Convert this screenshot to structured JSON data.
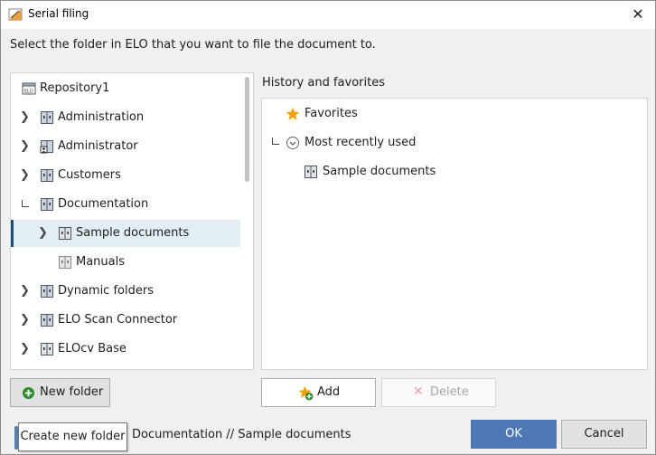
{
  "window": {
    "title": "Serial filing",
    "close_glyph": "✕"
  },
  "instruction": "Select the folder in ELO that you want to file the document to.",
  "tree": {
    "root": "Repository1",
    "items": [
      {
        "label": "Administration"
      },
      {
        "label": "Administrator"
      },
      {
        "label": "Customers"
      },
      {
        "label": "Documentation"
      },
      {
        "label": "Sample documents"
      },
      {
        "label": "Manuals"
      },
      {
        "label": "Dynamic folders"
      },
      {
        "label": "ELO Scan Connector"
      },
      {
        "label": "ELOcv Base"
      }
    ]
  },
  "history": {
    "heading": "History and favorites",
    "favorites": "Favorites",
    "recent": "Most recently used",
    "recent_item": "Sample documents"
  },
  "buttons": {
    "new_folder": "New folder",
    "add": "Add",
    "delete": "Delete",
    "ok": "OK",
    "cancel": "Cancel"
  },
  "tooltip": "Create new folder",
  "path": "Documentation // Sample documents",
  "colors": {
    "accent": "#4d78b3",
    "selection": "#e3edf4",
    "selection_bar": "#1f4e79",
    "favorite_star": "#f0a30a",
    "add_plus": "#2e8b2e",
    "delete_x": "#e8a0a0"
  }
}
